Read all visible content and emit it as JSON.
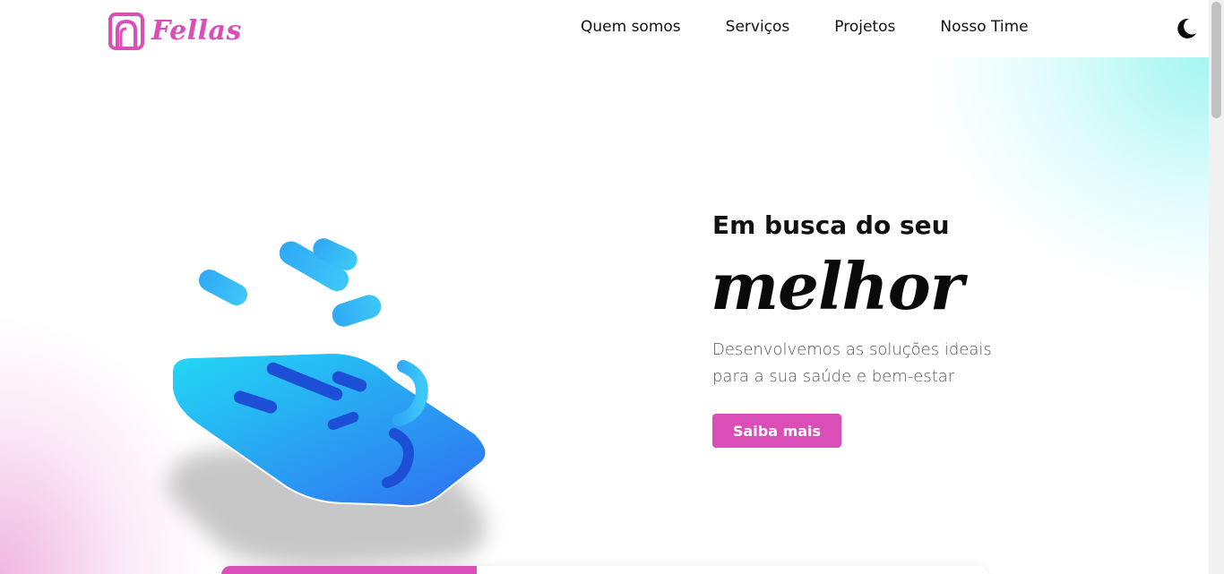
{
  "brand": {
    "name": "Fellas",
    "accent_color": "#d94fb7"
  },
  "nav": {
    "items": [
      {
        "label": "Quem somos"
      },
      {
        "label": "Serviços"
      },
      {
        "label": "Projetos"
      },
      {
        "label": "Nosso Time"
      }
    ],
    "theme_toggle_icon": "moon-icon"
  },
  "hero": {
    "headline": "Em busca do seu",
    "highlight": "melhor",
    "subtitle": "Desenvolvemos as soluções ideais para a sua saúde e bem-estar",
    "cta_label": "Saiba mais",
    "illustration_icon": "chat-bubble-3d-icon"
  },
  "colors": {
    "cta_bg": "#d94fb7",
    "illustration_blue": "#2f8ff0",
    "illustration_cyan": "#23d8f5"
  }
}
